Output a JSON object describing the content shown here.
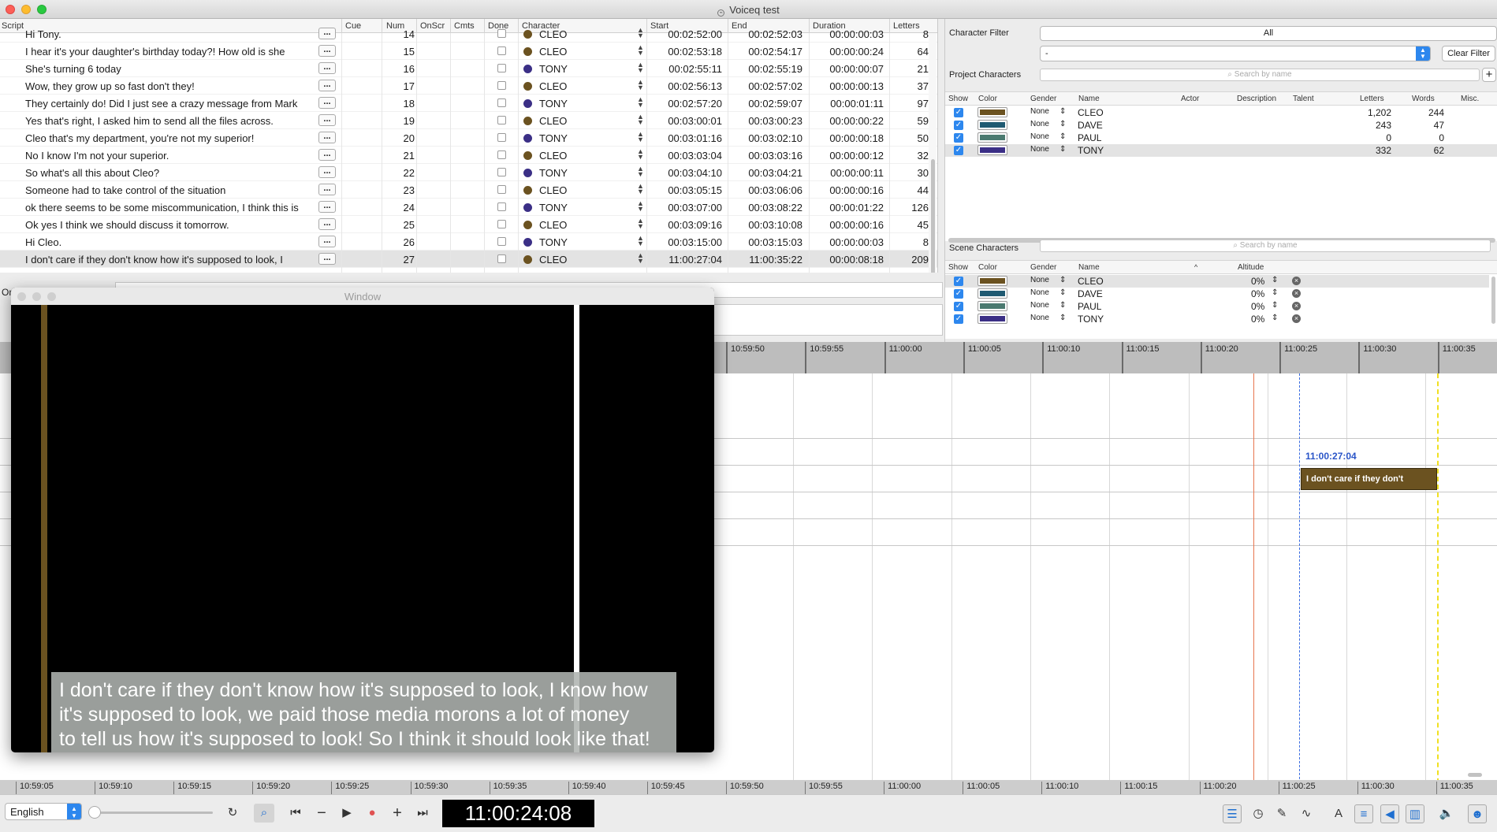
{
  "window": {
    "title": "Voiceq test"
  },
  "script_table": {
    "headers": {
      "script": "Script",
      "cue": "Cue",
      "num": "Num",
      "onscr": "OnScr",
      "cmts": "Cmts",
      "done": "Done",
      "character": "Character",
      "start": "Start",
      "end": "End",
      "duration": "Duration",
      "letters": "Letters"
    },
    "dots": "...",
    "rows": [
      {
        "script": "Hi Tony.",
        "num": "14",
        "character": "CLEO",
        "color": "#6b5220",
        "start": "00:02:52:00",
        "end": "00:02:52:03",
        "duration": "00:00:00:03",
        "letters": "8"
      },
      {
        "script": "I hear it's your daughter's birthday today?! How old is she",
        "num": "15",
        "character": "CLEO",
        "color": "#6b5220",
        "start": "00:02:53:18",
        "end": "00:02:54:17",
        "duration": "00:00:00:24",
        "letters": "64"
      },
      {
        "script": "She's turning 6 today",
        "num": "16",
        "character": "TONY",
        "color": "#3b2f86",
        "start": "00:02:55:11",
        "end": "00:02:55:19",
        "duration": "00:00:00:07",
        "letters": "21"
      },
      {
        "script": "Wow, they grow up so fast don't they!",
        "num": "17",
        "character": "CLEO",
        "color": "#6b5220",
        "start": "00:02:56:13",
        "end": "00:02:57:02",
        "duration": "00:00:00:13",
        "letters": "37"
      },
      {
        "script": "They certainly do! Did I just see a crazy message from Mark",
        "num": "18",
        "character": "TONY",
        "color": "#3b2f86",
        "start": "00:02:57:20",
        "end": "00:02:59:07",
        "duration": "00:00:01:11",
        "letters": "97"
      },
      {
        "script": "Yes that's right, I asked him to send all the files across.",
        "num": "19",
        "character": "CLEO",
        "color": "#6b5220",
        "start": "00:03:00:01",
        "end": "00:03:00:23",
        "duration": "00:00:00:22",
        "letters": "59"
      },
      {
        "script": "Cleo that's my department, you're not my superior!",
        "num": "20",
        "character": "TONY",
        "color": "#3b2f86",
        "start": "00:03:01:16",
        "end": "00:03:02:10",
        "duration": "00:00:00:18",
        "letters": "50"
      },
      {
        "script": "No I know I'm not your superior.",
        "num": "21",
        "character": "CLEO",
        "color": "#6b5220",
        "start": "00:03:03:04",
        "end": "00:03:03:16",
        "duration": "00:00:00:12",
        "letters": "32"
      },
      {
        "script": "So what's all this about Cleo?",
        "num": "22",
        "character": "TONY",
        "color": "#3b2f86",
        "start": "00:03:04:10",
        "end": "00:03:04:21",
        "duration": "00:00:00:11",
        "letters": "30"
      },
      {
        "script": "Someone had to take control of the situation",
        "num": "23",
        "character": "CLEO",
        "color": "#6b5220",
        "start": "00:03:05:15",
        "end": "00:03:06:06",
        "duration": "00:00:00:16",
        "letters": "44"
      },
      {
        "script": "ok there seems to be some miscommunication, I think this is",
        "num": "24",
        "character": "TONY",
        "color": "#3b2f86",
        "start": "00:03:07:00",
        "end": "00:03:08:22",
        "duration": "00:00:01:22",
        "letters": "126"
      },
      {
        "script": "Ok yes I think we should discuss it tomorrow.",
        "num": "25",
        "character": "CLEO",
        "color": "#6b5220",
        "start": "00:03:09:16",
        "end": "00:03:10:08",
        "duration": "00:00:00:16",
        "letters": "45"
      },
      {
        "script": "Hi Cleo.",
        "num": "26",
        "character": "TONY",
        "color": "#3b2f86",
        "start": "00:03:15:00",
        "end": "00:03:15:03",
        "duration": "00:00:00:03",
        "letters": "8"
      },
      {
        "script": "I don't care if they don't know how it's supposed to look, I",
        "num": "27",
        "character": "CLEO",
        "color": "#6b5220",
        "start": "11:00:27:04",
        "end": "11:00:35:22",
        "duration": "00:00:08:18",
        "letters": "209",
        "selected": true
      }
    ]
  },
  "mid": {
    "label": "Or"
  },
  "character_filter": {
    "label": "Character Filter",
    "all_button": "All",
    "select_value": "-",
    "clear_button": "Clear Filter"
  },
  "project_characters": {
    "label": "Project Characters",
    "search_placeholder": "Search by name",
    "add_button": "+",
    "headers": {
      "show": "Show",
      "color": "Color",
      "gender": "Gender",
      "name": "Name",
      "actor": "Actor",
      "description": "Description",
      "talent": "Talent",
      "letters": "Letters",
      "words": "Words",
      "misc": "Misc."
    },
    "rows": [
      {
        "gender": "None",
        "name": "CLEO",
        "color": "#6b5220",
        "letters": "1,202",
        "words": "244"
      },
      {
        "gender": "None",
        "name": "DAVE",
        "color": "#1f5a72",
        "letters": "243",
        "words": "47"
      },
      {
        "gender": "None",
        "name": "PAUL",
        "color": "#4b7a70",
        "letters": "0",
        "words": "0"
      },
      {
        "gender": "None",
        "name": "TONY",
        "color": "#3b2f86",
        "letters": "332",
        "words": "62",
        "selected": true
      }
    ]
  },
  "scene_characters": {
    "label": "Scene Characters",
    "search_placeholder": "Search by name",
    "headers": {
      "show": "Show",
      "color": "Color",
      "gender": "Gender",
      "name": "Name",
      "altitude": "Altitude"
    },
    "rows": [
      {
        "gender": "None",
        "name": "CLEO",
        "color": "#6b5220",
        "altitude": "0%",
        "selected": true
      },
      {
        "gender": "None",
        "name": "DAVE",
        "color": "#1f5a72",
        "altitude": "0%"
      },
      {
        "gender": "None",
        "name": "PAUL",
        "color": "#4b7a70",
        "altitude": "0%"
      },
      {
        "gender": "None",
        "name": "TONY",
        "color": "#3b2f86",
        "altitude": "0%"
      }
    ]
  },
  "timeline": {
    "top_ticks": [
      "10:59:50",
      "10:59:55",
      "11:00:00",
      "11:00:05",
      "11:00:10",
      "11:00:15",
      "11:00:20",
      "11:00:25",
      "11:00:30",
      "11:00:35"
    ],
    "bottom_ticks": [
      "10:59:05",
      "10:59:10",
      "10:59:15",
      "10:59:20",
      "10:59:25",
      "10:59:30",
      "10:59:35",
      "10:59:40",
      "10:59:45",
      "10:59:50",
      "10:59:55",
      "11:00:00",
      "11:00:05",
      "11:00:10",
      "11:00:15",
      "11:00:20",
      "11:00:25",
      "11:00:30",
      "11:00:35"
    ],
    "clip_timecode": "11:00:27:04",
    "clip_text": "I don't care if they don't",
    "clip_color": "#6b5220"
  },
  "video_window": {
    "title": "Window",
    "subtitle": "I don't care if they don't know how it's supposed to look, I know how\nit's supposed to look, we paid those media morons a lot of money\nto tell us how it's supposed to look! So I think it should look like that!"
  },
  "toolbar": {
    "language": "English",
    "timecode": "11:00:24:08"
  }
}
